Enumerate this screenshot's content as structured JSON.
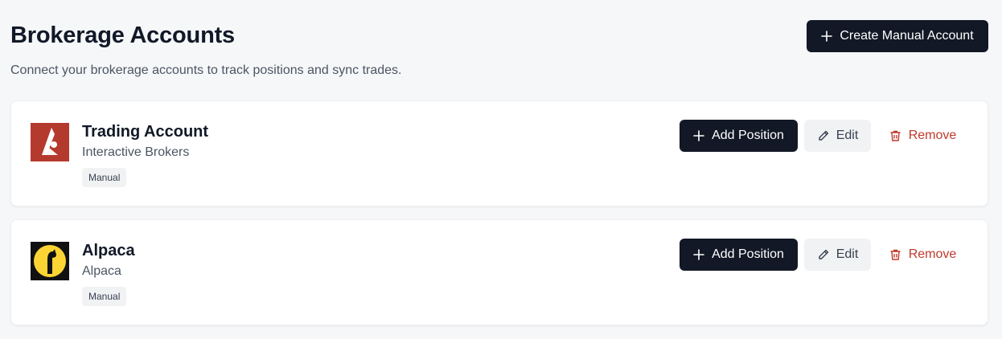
{
  "page": {
    "title": "Brokerage Accounts",
    "subtitle": "Connect your brokerage accounts to track positions and sync trades.",
    "create_button_label": "Create Manual Account",
    "create_button_icon": "plus-icon"
  },
  "accounts": [
    {
      "name": "Trading Account",
      "broker": "Interactive Brokers",
      "badge": "Manual",
      "logo": "interactive-brokers-logo",
      "logo_color": "#b53a2e",
      "add_label": "Add Position",
      "edit_label": "Edit",
      "remove_label": "Remove"
    },
    {
      "name": "Alpaca",
      "broker": "Alpaca",
      "badge": "Manual",
      "logo": "alpaca-logo",
      "logo_color": "#fcd535",
      "add_label": "Add Position",
      "edit_label": "Edit",
      "remove_label": "Remove"
    }
  ],
  "colors": {
    "background": "#f6f7f9",
    "primary_button": "#121826",
    "secondary_button": "#f1f2f4",
    "danger_text": "#c0392b"
  }
}
